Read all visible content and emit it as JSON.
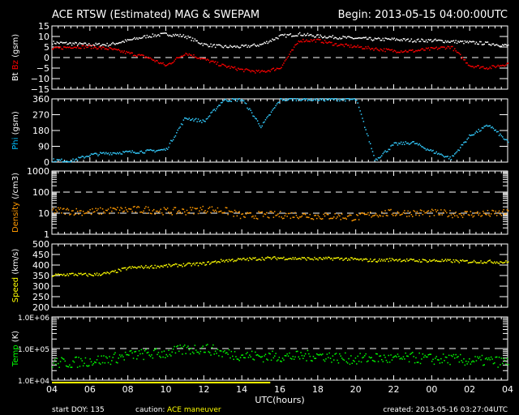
{
  "header": {
    "title": "ACE RTSW (Estimated) MAG & SWEPAM",
    "begin": "Begin: 2013-05-15 04:00:00UTC"
  },
  "footer": {
    "start_doy": "start DOY: 135",
    "caution_label": "caution:",
    "caution_text": "ACE maneuver",
    "created": "created: 2013-05-16 03:27:04UTC",
    "caution_color": "#ffff00",
    "caution_range_hours": [
      0,
      11.5
    ]
  },
  "chart_data": {
    "type": "scatter",
    "x_unit": "hours since 2013-05-15 04:00 UTC",
    "xlabel": "UTC(hours)",
    "xlim": [
      0,
      24
    ],
    "x_tick_labels": [
      "04",
      "06",
      "08",
      "10",
      "12",
      "14",
      "16",
      "18",
      "20",
      "22",
      "00",
      "02",
      "04"
    ],
    "hours": [
      0,
      1,
      2,
      3,
      4,
      5,
      6,
      7,
      8,
      9,
      10,
      11,
      12,
      13,
      14,
      15,
      16,
      17,
      18,
      19,
      20,
      21,
      22,
      23,
      24
    ],
    "panels": [
      {
        "ylabel_parts": [
          {
            "text": "Bt",
            "color": "#ffffff"
          },
          {
            "text": "Bz",
            "color": "#ff0000"
          },
          {
            "text": "(gsm)",
            "color": "#ffffff"
          }
        ],
        "scale": "linear",
        "ylim": [
          -15,
          15
        ],
        "ticks": [
          15,
          10,
          5,
          0,
          -5,
          -10,
          -15
        ],
        "tick_labels": [
          "15",
          "10",
          "5",
          "0",
          "−5",
          "−10",
          "−15"
        ],
        "dashed_ref": 0,
        "series": [
          {
            "name": "Bt",
            "color": "#ffffff",
            "values": [
              7,
              6.5,
              6,
              6,
              8,
              10,
              11,
              10,
              6,
              5,
              5,
              6,
              10,
              11,
              10,
              9.5,
              9,
              8.5,
              8.5,
              8,
              8,
              7.5,
              7,
              6.5,
              5.5
            ]
          },
          {
            "name": "Bz",
            "color": "#ff0000",
            "values": [
              4,
              5,
              5,
              4,
              2,
              0,
              -4,
              2,
              -1,
              -4,
              -6,
              -7,
              -5,
              8,
              8,
              6,
              5,
              4,
              3,
              3,
              4,
              5,
              -4,
              -5,
              -3
            ]
          }
        ]
      },
      {
        "ylabel_parts": [
          {
            "text": "Phi",
            "color": "#00bfff"
          },
          {
            "text": "(gsm)",
            "color": "#ffffff"
          }
        ],
        "scale": "linear",
        "ylim": [
          0,
          360
        ],
        "ticks": [
          360,
          270,
          180,
          90,
          0
        ],
        "tick_labels": [
          "360",
          "270",
          "180",
          "90",
          "0"
        ],
        "series": [
          {
            "name": "Phi",
            "color": "#33ccff",
            "values": [
              10,
              5,
              40,
              50,
              55,
              60,
              70,
              250,
              230,
              350,
              355,
              200,
              355,
              358,
              355,
              356,
              355,
              10,
              100,
              110,
              60,
              20,
              150,
              210,
              110
            ]
          }
        ]
      },
      {
        "ylabel_parts": [
          {
            "text": "Density",
            "color": "#ff9900"
          },
          {
            "text": "(/cm3)",
            "color": "#ffffff"
          }
        ],
        "scale": "log",
        "ylim": [
          1,
          1000
        ],
        "ticks": [
          1000,
          100,
          10,
          1
        ],
        "tick_labels": [
          "1000",
          "100",
          "10",
          "1"
        ],
        "dashed_ref": [
          100,
          10
        ],
        "series": [
          {
            "name": "Density",
            "color": "#ff9900",
            "values": [
              13,
              12,
              11,
              13,
              14,
              14,
              12,
              12,
              15,
              13,
              7,
              8,
              8,
              8,
              7,
              7,
              6,
              9,
              10,
              10,
              10,
              9,
              9,
              9,
              10
            ]
          }
        ]
      },
      {
        "ylabel_parts": [
          {
            "text": "Speed",
            "color": "#ffff00"
          },
          {
            "text": "(km/s)",
            "color": "#ffffff"
          }
        ],
        "scale": "linear",
        "ylim": [
          200,
          500
        ],
        "ticks": [
          500,
          450,
          400,
          350,
          300,
          250,
          200
        ],
        "tick_labels": [
          "500",
          "450",
          "400",
          "350",
          "300",
          "250",
          "200"
        ],
        "series": [
          {
            "name": "Speed",
            "color": "#ffff00",
            "values": [
              350,
              355,
              352,
              360,
              385,
              390,
              395,
              400,
              405,
              420,
              425,
              430,
              432,
              430,
              428,
              430,
              425,
              420,
              425,
              420,
              420,
              418,
              415,
              415,
              412
            ]
          }
        ]
      },
      {
        "ylabel_parts": [
          {
            "text": "Temp",
            "color": "#00ff00"
          },
          {
            "text": "(K)",
            "color": "#ffffff"
          }
        ],
        "scale": "log",
        "ylim": [
          10000,
          1000000
        ],
        "ticks": [
          1000000,
          100000,
          10000
        ],
        "tick_labels": [
          "1.0E+06",
          "1.0E+05",
          "1.0E+04"
        ],
        "dashed_ref": [
          100000
        ],
        "series": [
          {
            "name": "Temp",
            "color": "#00ff00",
            "values": [
              35000,
              35000,
              40000,
              45000,
              60000,
              65000,
              70000,
              90000,
              100000,
              70000,
              60000,
              55000,
              55000,
              55000,
              60000,
              50000,
              45000,
              50000,
              45000,
              50000,
              45000,
              45000,
              40000,
              40000,
              35000
            ]
          }
        ]
      }
    ]
  }
}
